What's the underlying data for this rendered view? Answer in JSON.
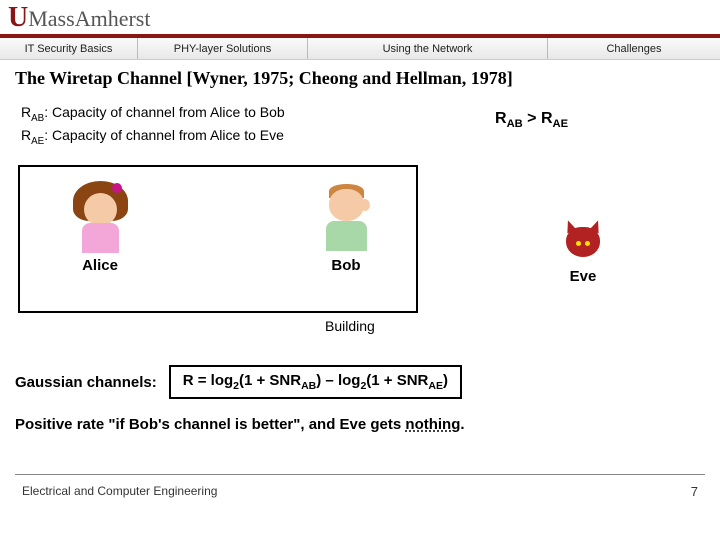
{
  "header": {
    "logo_u": "U",
    "logo_mass": "Mass",
    "logo_amherst": "Amherst"
  },
  "nav": {
    "items": [
      {
        "label": "IT Security Basics"
      },
      {
        "label": "PHY-layer Solutions"
      },
      {
        "label": "Using the Network"
      },
      {
        "label": "Challenges"
      }
    ]
  },
  "title": "The Wiretap Channel [Wyner, 1975; Cheong and Hellman, 1978]",
  "defs": {
    "rab_lbl": "R",
    "rab_sub": "AB",
    "rab_txt": ":  Capacity of channel from Alice to Bob",
    "rae_lbl": "R",
    "rae_sub": "AE",
    "rae_txt": ":  Capacity of channel from Alice to Eve"
  },
  "ineq": {
    "r1": "R",
    "s1": "AB",
    "gt": " > ",
    "r2": "R",
    "s2": "AE"
  },
  "actors": {
    "alice": "Alice",
    "bob": "Bob",
    "eve": "Eve",
    "building": "Building"
  },
  "gaussian": {
    "label": "Gaussian channels:",
    "formula_pre": "R = log",
    "two_a": "2",
    "mid_a": "(1 + SNR",
    "sub_a": "AB",
    "close_a": ") – log",
    "two_b": "2",
    "mid_b": "(1 + SNR",
    "sub_b": "AE",
    "close_b": ")"
  },
  "positive": {
    "p1": "Positive rate \"if Bob's channel is better\", and Eve gets ",
    "p2": "nothing",
    "p3": "."
  },
  "footer": {
    "left": "Electrical and Computer Engineering",
    "right": "7"
  }
}
